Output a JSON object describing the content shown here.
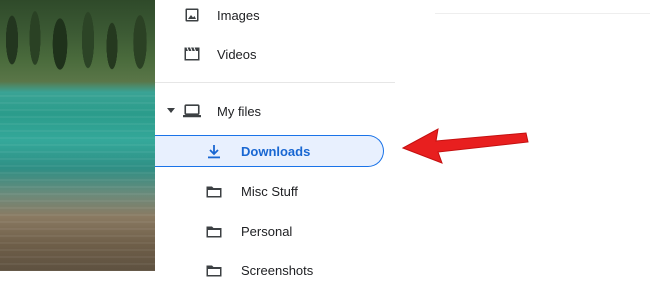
{
  "sidebar": {
    "items": [
      {
        "label": "Images",
        "icon": "image-icon"
      },
      {
        "label": "Videos",
        "icon": "video-icon"
      },
      {
        "label": "My files",
        "icon": "laptop-icon"
      },
      {
        "label": "Downloads",
        "icon": "download-icon",
        "selected": true
      },
      {
        "label": "Misc Stuff",
        "icon": "folder-icon"
      },
      {
        "label": "Personal",
        "icon": "folder-icon"
      },
      {
        "label": "Screenshots",
        "icon": "folder-icon"
      }
    ]
  },
  "colors": {
    "selected_bg": "#e8f0fe",
    "selected_border": "#1a73e8",
    "selected_text": "#1967d2",
    "annotation_arrow": "#e81f1f"
  }
}
